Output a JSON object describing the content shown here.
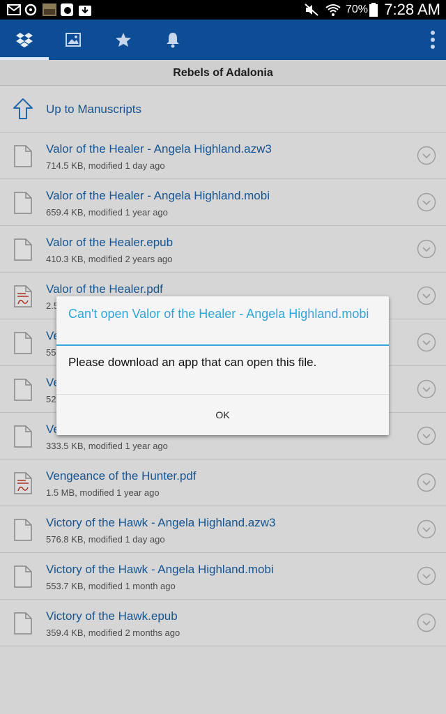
{
  "status_bar": {
    "battery_percent": "70%",
    "time": "7:28 AM"
  },
  "toolbar": {
    "tabs": [
      {
        "icon": "dropbox-icon"
      },
      {
        "icon": "photos-icon"
      },
      {
        "icon": "star-icon"
      },
      {
        "icon": "bell-icon"
      }
    ],
    "overflow_icon": "more-vertical-icon"
  },
  "folder": {
    "title": "Rebels of Adalonia",
    "up_label": "Up to Manuscripts"
  },
  "files": [
    {
      "name": "Valor of the Healer - Angela Highland.azw3",
      "meta": "714.5 KB, modified 1 day ago",
      "type": "doc"
    },
    {
      "name": "Valor of the Healer - Angela Highland.mobi",
      "meta": "659.4 KB, modified 1 year ago",
      "type": "doc"
    },
    {
      "name": "Valor of the Healer.epub",
      "meta": "410.3 KB, modified 2 years ago",
      "type": "doc"
    },
    {
      "name": "Valor of the Healer.pdf",
      "meta": "2.5",
      "type": "pdf"
    },
    {
      "name": "Ve",
      "meta": "55",
      "type": "doc"
    },
    {
      "name": "Ve",
      "meta": "52",
      "type": "doc"
    },
    {
      "name": "Ve",
      "meta": "333.5 KB, modified 1 year ago",
      "type": "doc"
    },
    {
      "name": "Vengeance of the Hunter.pdf",
      "meta": "1.5 MB, modified 1 year ago",
      "type": "pdf"
    },
    {
      "name": "Victory of the Hawk - Angela Highland.azw3",
      "meta": "576.8 KB, modified 1 day ago",
      "type": "doc"
    },
    {
      "name": "Victory of the Hawk - Angela Highland.mobi",
      "meta": "553.7 KB, modified 1 month ago",
      "type": "doc"
    },
    {
      "name": "Victory of the Hawk.epub",
      "meta": "359.4 KB, modified 2 months ago",
      "type": "doc"
    }
  ],
  "dialog": {
    "title": "Can't open Valor of the Healer - Angela Highland.mobi",
    "message": "Please download an app that can open this file.",
    "ok_label": "OK"
  },
  "colors": {
    "action_bar": "#0d4d96",
    "link": "#1a61a6",
    "dialog_accent": "#33a7dc"
  }
}
